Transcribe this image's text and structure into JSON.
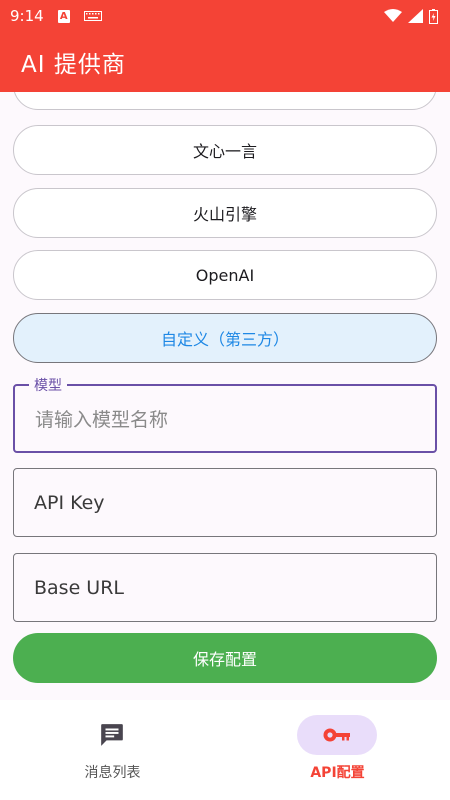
{
  "status_bar": {
    "time": "9:14",
    "badge_a": "A",
    "icons": [
      "wifi-icon",
      "signal-icon",
      "battery-icon"
    ]
  },
  "app_bar": {
    "title": "AI 提供商"
  },
  "providers": [
    {
      "label": ""
    },
    {
      "label": "文心一言"
    },
    {
      "label": "火山引擎"
    },
    {
      "label": "OpenAI"
    },
    {
      "label": "自定义（第三方）",
      "selected": true
    }
  ],
  "form": {
    "model": {
      "label": "模型",
      "placeholder": "请输入模型名称"
    },
    "api_key": {
      "placeholder": "API Key"
    },
    "base_url": {
      "placeholder": "Base URL"
    },
    "save_label": "保存配置"
  },
  "bottom_nav": [
    {
      "label": "消息列表",
      "icon": "message-icon",
      "active": false
    },
    {
      "label": "API配置",
      "icon": "key-icon",
      "active": true
    }
  ],
  "colors": {
    "primary": "#f44336",
    "selected_bg": "#e3f1fc",
    "selected_text": "#1e88e5",
    "focus": "#6a50a7",
    "save": "#4caf50",
    "nav_indicator": "#e9ddfa"
  }
}
